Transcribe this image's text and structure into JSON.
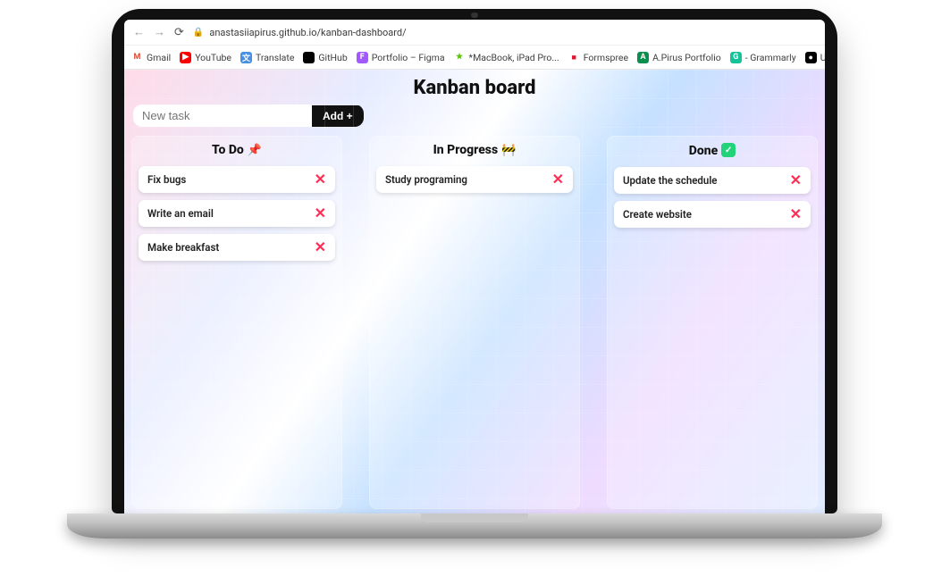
{
  "browser": {
    "url": "anastasiiapirus.github.io/kanban-dashboard/"
  },
  "bookmarks": [
    {
      "label": "Gmail",
      "iconText": "M",
      "iconBg": "#ffffff",
      "iconColor": "#dd4b39"
    },
    {
      "label": "YouTube",
      "iconText": "▶",
      "iconBg": "#ff0000",
      "iconColor": "#ffffff"
    },
    {
      "label": "Translate",
      "iconText": "文",
      "iconBg": "#4a90e2",
      "iconColor": "#ffffff"
    },
    {
      "label": "GitHub",
      "iconText": "",
      "iconBg": "#000000",
      "iconColor": "#ffffff"
    },
    {
      "label": "Portfolio – Figma",
      "iconText": "F",
      "iconBg": "#a259ff",
      "iconColor": "#ffffff"
    },
    {
      "label": "*MacBook, iPad Pro...",
      "iconText": "★",
      "iconBg": "#ffffff",
      "iconColor": "#55c500"
    },
    {
      "label": "Formspree",
      "iconText": "■",
      "iconBg": "#ffffff",
      "iconColor": "#e5122e"
    },
    {
      "label": "A.Pirus Portfolio",
      "iconText": "A",
      "iconBg": "#0a8f4e",
      "iconColor": "#ffffff"
    },
    {
      "label": "- Grammarly",
      "iconText": "G",
      "iconBg": "#15c39a",
      "iconColor": "#ffffff"
    },
    {
      "label": "Updating the U",
      "iconText": "●",
      "iconBg": "#000000",
      "iconColor": "#ffffff"
    }
  ],
  "app": {
    "title": "Kanban board",
    "newTask": {
      "placeholder": "New task",
      "value": "",
      "addLabel": "Add +"
    },
    "columns": [
      {
        "title": "To Do",
        "emoji": "📌",
        "cards": [
          {
            "text": "Fix bugs"
          },
          {
            "text": "Write an email"
          },
          {
            "text": "Make breakfast"
          }
        ]
      },
      {
        "title": "In Progress",
        "emoji": "🚧",
        "cards": [
          {
            "text": "Study programing"
          }
        ]
      },
      {
        "title": "Done",
        "emoji": "done-badge",
        "cards": [
          {
            "text": "Update the schedule"
          },
          {
            "text": "Create website"
          }
        ]
      }
    ]
  }
}
